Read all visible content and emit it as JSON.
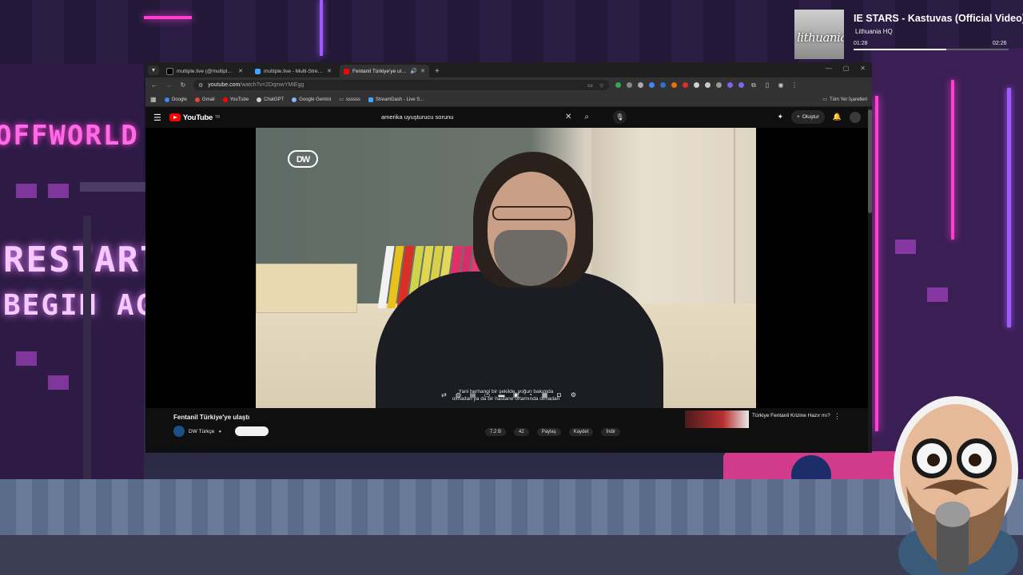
{
  "browser": {
    "tabs": [
      {
        "title": "multiple.live (@multiple_live) / X",
        "favicon_color": "#000000",
        "active": false
      },
      {
        "title": "multiple.live - Multi-Stream Dash",
        "favicon_color": "#3ea6ff",
        "active": false
      },
      {
        "title": "Fentanil Türkiye'ye ulaştı - YouTube",
        "favicon_color": "#ff0000",
        "active": true
      }
    ],
    "new_tab": "+",
    "url_host": "youtube.com",
    "url_path": "/watch?v=2DqmwYMiEgg",
    "bookmarks": [
      {
        "label": "Google",
        "color": "#4285f4"
      },
      {
        "label": "Gmail",
        "color": "#ea4335"
      },
      {
        "label": "YouTube",
        "color": "#ff0000"
      },
      {
        "label": "ChatGPT",
        "color": "#d0d0d0"
      },
      {
        "label": "Google Gemini",
        "color": "#8ab4f8"
      },
      {
        "label": "ssssss",
        "color": "#c0c0c0"
      },
      {
        "label": "StreamDash - Live S...",
        "color": "#3ea6ff"
      }
    ],
    "all_bookmarks": "Tüm Yer İşaretleri"
  },
  "youtube": {
    "logo": "YouTube",
    "logo_region": "TR",
    "search_query": "amerika uyuşturucu sorunu",
    "create_label": "Oluştur",
    "video_logo": "DW",
    "subtitles": [
      "Yani herhangi bir şekilde, yoğun bakımda",
      "olmadan ya da bir hastane ortamında olmadan"
    ],
    "video_title": "Fentanil Türkiye'ye ulaştı",
    "channel_name": "DW Türkçe",
    "actions": [
      "7,2 B",
      "42",
      "Paylaş",
      "Kaydet",
      "İndir"
    ],
    "recommended_title": "Türkiye Fentanil Krizine Hazır mı?"
  },
  "now_playing": {
    "title": "IE STARS - Kastuvas (Official Video)",
    "artist": "Lithuania HQ",
    "art_text": "lithuania",
    "elapsed": "01:28",
    "duration": "02:26",
    "progress": 0.6
  },
  "scene": {
    "sign1": "OFFWORLD",
    "sign2": "RESTART",
    "sign3": "BEGIN AGAIN"
  },
  "colors": {
    "accent": "#ff0000",
    "neon": "#ff3fd2"
  }
}
